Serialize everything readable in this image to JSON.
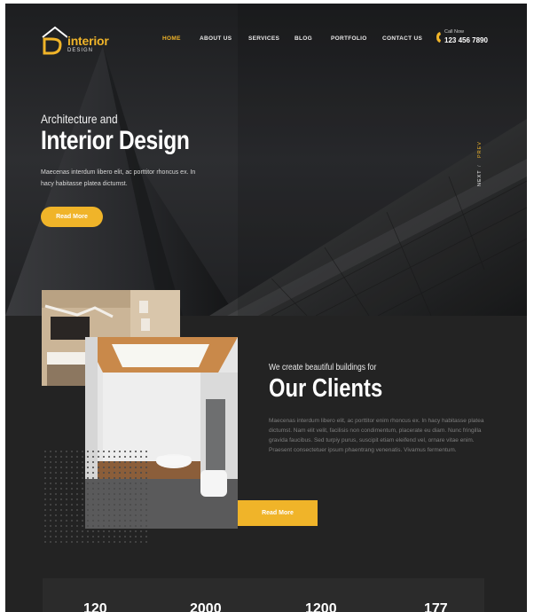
{
  "brand": {
    "name": "interior",
    "tagline": "DESIGN",
    "accent": "#f0b429"
  },
  "nav": {
    "items": [
      {
        "label": "HOME",
        "active": true
      },
      {
        "label": "ABOUT US"
      },
      {
        "label": "SERVICES"
      },
      {
        "label": "BLOG"
      },
      {
        "label": "PORTFOLIO"
      },
      {
        "label": "CONTACT US"
      }
    ]
  },
  "call": {
    "label": "Call Now",
    "number": "123 456 7890",
    "icon": "phone-icon"
  },
  "hero": {
    "subtitle": "Architecture and",
    "title": "Interior Design",
    "text": "Maecenas interdum libero elit, ac porttitor rhoncus ex. In hacy habitasse platea dictumst.",
    "button": "Read More",
    "next": "NEXT",
    "separator": "/",
    "prev": "PREV"
  },
  "clients": {
    "subtitle": "We create beautiful buildings for",
    "title": "Our Clients",
    "text": "Maecenas interdum libero elit, ac porttitor enim rhoncus ex. In hacy habitasse platea dictumst. Nam elit velit, facilisis non condimentum, placerate eu diam. Nunc fringilla gravida faucibus. Sed turpiy purus, suscipit etiam eleifend vel, ornare vitae enim. Praesent consectetuer ipsum phaentrang venenatis. Vivamus fermentum.",
    "button": "Read More"
  },
  "stats": {
    "values": [
      "120",
      "2000",
      "1200",
      "177"
    ]
  }
}
